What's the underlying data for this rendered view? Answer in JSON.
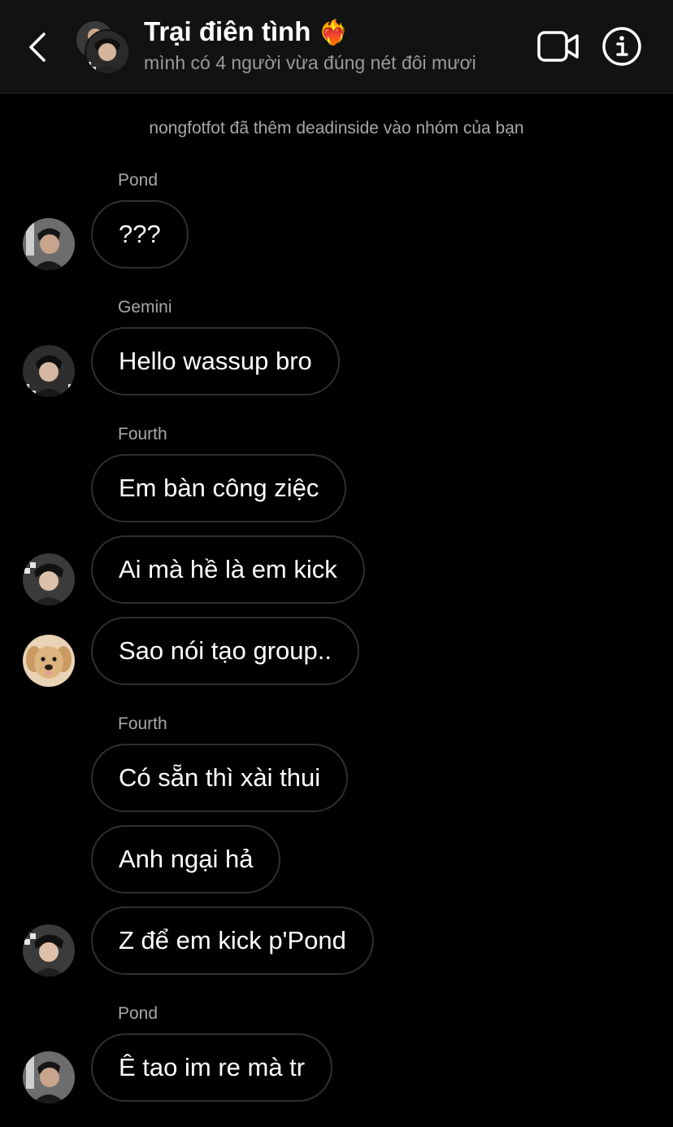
{
  "header": {
    "title": "Trại điên tình",
    "title_emoji": "❤️‍🔥",
    "subtitle": "mình có 4 người vừa đúng nét đôi mươi",
    "icons": {
      "back": "chevron-left-icon",
      "video": "video-call-icon",
      "info": "info-icon"
    }
  },
  "system_message": "nongfotfot đã thêm deadinside vào nhóm của bạn",
  "messages": [
    {
      "sender": "Pond",
      "text": "???"
    },
    {
      "sender": "Gemini",
      "text": "Hello wassup bro"
    },
    {
      "sender": "Fourth",
      "text": "Em bàn công ziệc"
    },
    {
      "sender": "",
      "text": "Ai mà hề là em kick"
    },
    {
      "sender": "",
      "text": "Sao nói tạo group.."
    },
    {
      "sender": "Fourth",
      "text": "Có sẵn thì xài thui"
    },
    {
      "sender": "",
      "text": "Anh ngại hả"
    },
    {
      "sender": "",
      "text": "Z để em kick p'Pond"
    },
    {
      "sender": "Pond",
      "text": "Ê tao im re mà tr"
    }
  ],
  "colors": {
    "background": "#000000",
    "header_bg": "#121212",
    "bubble_border": "#2f2f2f",
    "secondary_text": "#a8a8a8",
    "emoji_red": "#e8454a"
  }
}
